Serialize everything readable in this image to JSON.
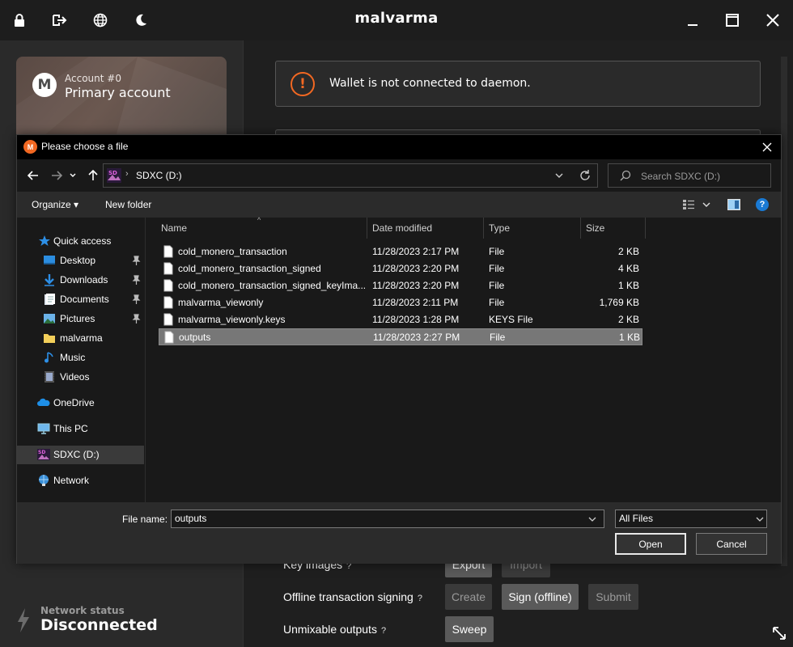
{
  "app": {
    "title": "malvarma",
    "account": {
      "number": "Account #0",
      "name": "Primary account"
    },
    "warning": "Wallet is not connected to daemon.",
    "rows": [
      {
        "label": "Key images",
        "buttons": [
          "Export",
          "Import"
        ]
      },
      {
        "label": "Offline transaction signing",
        "buttons": [
          "Create",
          "Sign (offline)",
          "Submit"
        ]
      },
      {
        "label": "Unmixable outputs",
        "buttons": [
          "Sweep"
        ]
      }
    ],
    "network": {
      "label": "Network status",
      "value": "Disconnected"
    },
    "help_mark": "?"
  },
  "dialog": {
    "title": "Please choose a file",
    "address": {
      "location": "SDXC (D:)",
      "separator": "›"
    },
    "search_placeholder": "Search SDXC (D:)",
    "commands": {
      "organize": "Organize ▾",
      "new_folder": "New folder",
      "help": "?"
    },
    "nav": [
      {
        "label": "Quick access",
        "icon": "star-icon",
        "pinned": false
      },
      {
        "label": "Desktop",
        "icon": "desktop-icon",
        "pinned": true
      },
      {
        "label": "Downloads",
        "icon": "download-icon",
        "pinned": true
      },
      {
        "label": "Documents",
        "icon": "documents-icon",
        "pinned": true
      },
      {
        "label": "Pictures",
        "icon": "pictures-icon",
        "pinned": true
      },
      {
        "label": "malvarma",
        "icon": "folder-icon",
        "pinned": false
      },
      {
        "label": "Music",
        "icon": "music-icon",
        "pinned": false
      },
      {
        "label": "Videos",
        "icon": "videos-icon",
        "pinned": false
      },
      {
        "label": "OneDrive",
        "icon": "cloud-icon",
        "pinned": false
      },
      {
        "label": "This PC",
        "icon": "computer-icon",
        "pinned": false
      },
      {
        "label": "SDXC (D:)",
        "icon": "drive-icon",
        "pinned": false,
        "selected": true
      },
      {
        "label": "Network",
        "icon": "network-icon",
        "pinned": false
      }
    ],
    "columns": [
      "Name",
      "Date modified",
      "Type",
      "Size"
    ],
    "files": [
      {
        "name": "cold_monero_transaction",
        "date": "11/28/2023 2:17 PM",
        "type": "File",
        "size": "2 KB"
      },
      {
        "name": "cold_monero_transaction_signed",
        "date": "11/28/2023 2:20 PM",
        "type": "File",
        "size": "4 KB"
      },
      {
        "name": "cold_monero_transaction_signed_keyIma...",
        "date": "11/28/2023 2:20 PM",
        "type": "File",
        "size": "1 KB"
      },
      {
        "name": "malvarma_viewonly",
        "date": "11/28/2023 2:11 PM",
        "type": "File",
        "size": "1,769 KB"
      },
      {
        "name": "malvarma_viewonly.keys",
        "date": "11/28/2023 1:28 PM",
        "type": "KEYS File",
        "size": "2 KB"
      },
      {
        "name": "outputs",
        "date": "11/28/2023 2:27 PM",
        "type": "File",
        "size": "1 KB",
        "selected": true
      }
    ],
    "file_name_label": "File name:",
    "file_name_value": "outputs",
    "file_type": "All Files",
    "open_label": "Open",
    "cancel_label": "Cancel"
  },
  "colors": {
    "accent": "#f26822",
    "help_blue": "#1a7ad4",
    "selection": "#777777"
  }
}
